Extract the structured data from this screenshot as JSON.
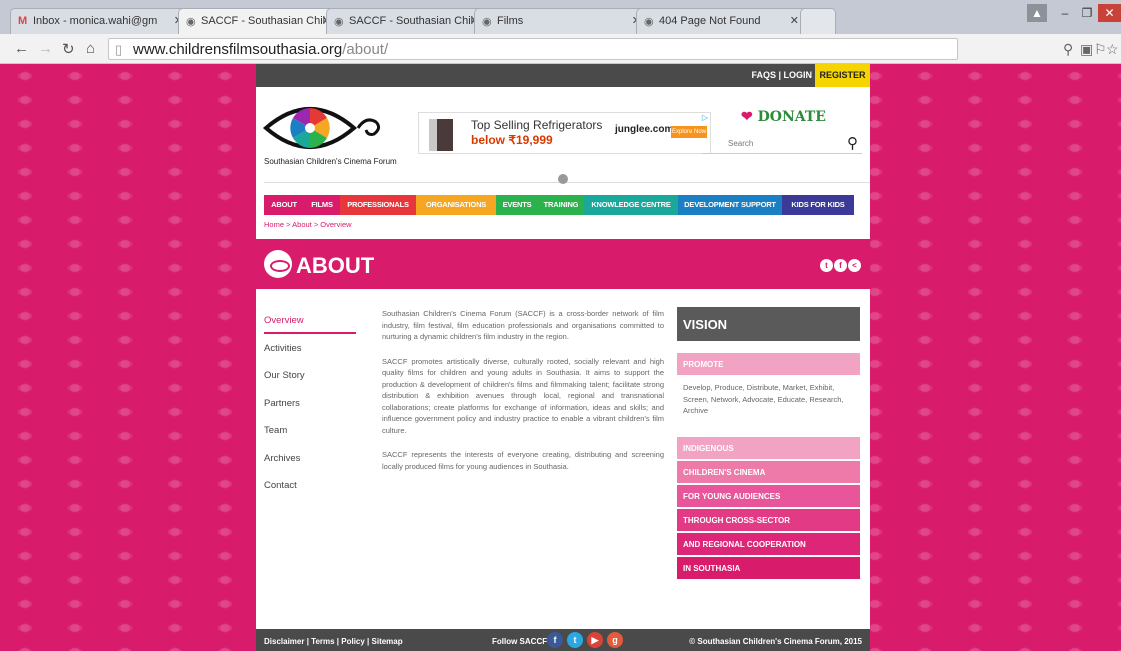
{
  "browser": {
    "tabs": [
      {
        "title": "Inbox - monica.wahi@gm",
        "icon": "gmail-icon"
      },
      {
        "title": "SACCF - Southasian Child",
        "icon": "eye-icon"
      },
      {
        "title": "SACCF - Southasian Child",
        "icon": "eye-icon"
      },
      {
        "title": "Films",
        "icon": "eye-icon"
      },
      {
        "title": "404 Page Not Found",
        "icon": "eye-icon"
      }
    ],
    "url_host": "www.childrensfilmsouthasia.org",
    "url_path": "/about/"
  },
  "topbar": {
    "faqs_login": "FAQS | LOGIN",
    "register": "REGISTER"
  },
  "logo": {
    "text": "Southasian Children's Cinema Forum"
  },
  "ad": {
    "line1": "Top Selling Refrigerators",
    "line2": "below ₹19,999",
    "brand": "junglee.com",
    "button": "Explore Now"
  },
  "donate": {
    "label": "DONATE"
  },
  "search": {
    "placeholder": "Search"
  },
  "nav": [
    {
      "label": "ABOUT",
      "color": "#d81b6b"
    },
    {
      "label": "FILMS",
      "color": "#d81b6b"
    },
    {
      "label": "PROFESSIONALS",
      "color": "#e8373c"
    },
    {
      "label": "ORGANISATIONS",
      "color": "#f5a623"
    },
    {
      "label": "EVENTS",
      "color": "#2bb24c"
    },
    {
      "label": "TRAINING",
      "color": "#2bb24c"
    },
    {
      "label": "KNOWLEDGE CENTRE",
      "color": "#1aa89a"
    },
    {
      "label": "DEVELOPMENT SUPPORT",
      "color": "#1b7fc4"
    },
    {
      "label": "KIDS FOR KIDS",
      "color": "#3b3a98"
    }
  ],
  "breadcrumb": "Home > About > Overview",
  "page_title": "ABOUT",
  "sidenav": [
    "Overview",
    "Activities",
    "Our Story",
    "Partners",
    "Team",
    "Archives",
    "Contact"
  ],
  "content": {
    "p1": "Southasian Children's Cinema Forum (SACCF) is a cross-border network of film industry, film festival, film education professionals and organisations committed to nurturing a dynamic children's film industry in the region.",
    "p2": "SACCF promotes artistically diverse, culturally rooted, socially relevant and high quality films for children and young adults in Southasia. It aims to support the production & development of children's films and filmmaking talent; facilitate strong distribution & exhibition avenues through local, regional and transnational collaborations; create platforms for exchange of information, ideas and skills; and influence government policy and industry practice to enable a vibrant children's film culture.",
    "p3": "SACCF represents the interests of everyone creating, distributing and screening locally produced films for young audiences in Southasia."
  },
  "vision": {
    "title": "VISION",
    "promote": "PROMOTE",
    "promote_text": "Develop, Produce, Distribute, Market, Exhibit, Screen, Network, Advocate, Educate, Research, Archive",
    "items": [
      "INDIGENOUS",
      "CHILDREN'S CINEMA",
      "FOR YOUNG AUDIENCES",
      "THROUGH CROSS-SECTOR",
      "AND REGIONAL COOPERATION",
      "IN SOUTHASIA"
    ]
  },
  "footer": {
    "links": "Disclaimer  | Terms  | Policy  | Sitemap",
    "follow": "Follow SACCF",
    "copyright": "© Southasian Children's Cinema Forum, 2015"
  },
  "colors": {
    "brand_pink": "#d81b6b",
    "dark_grey": "#4a4a4a",
    "register_yellow": "#f5d400"
  }
}
